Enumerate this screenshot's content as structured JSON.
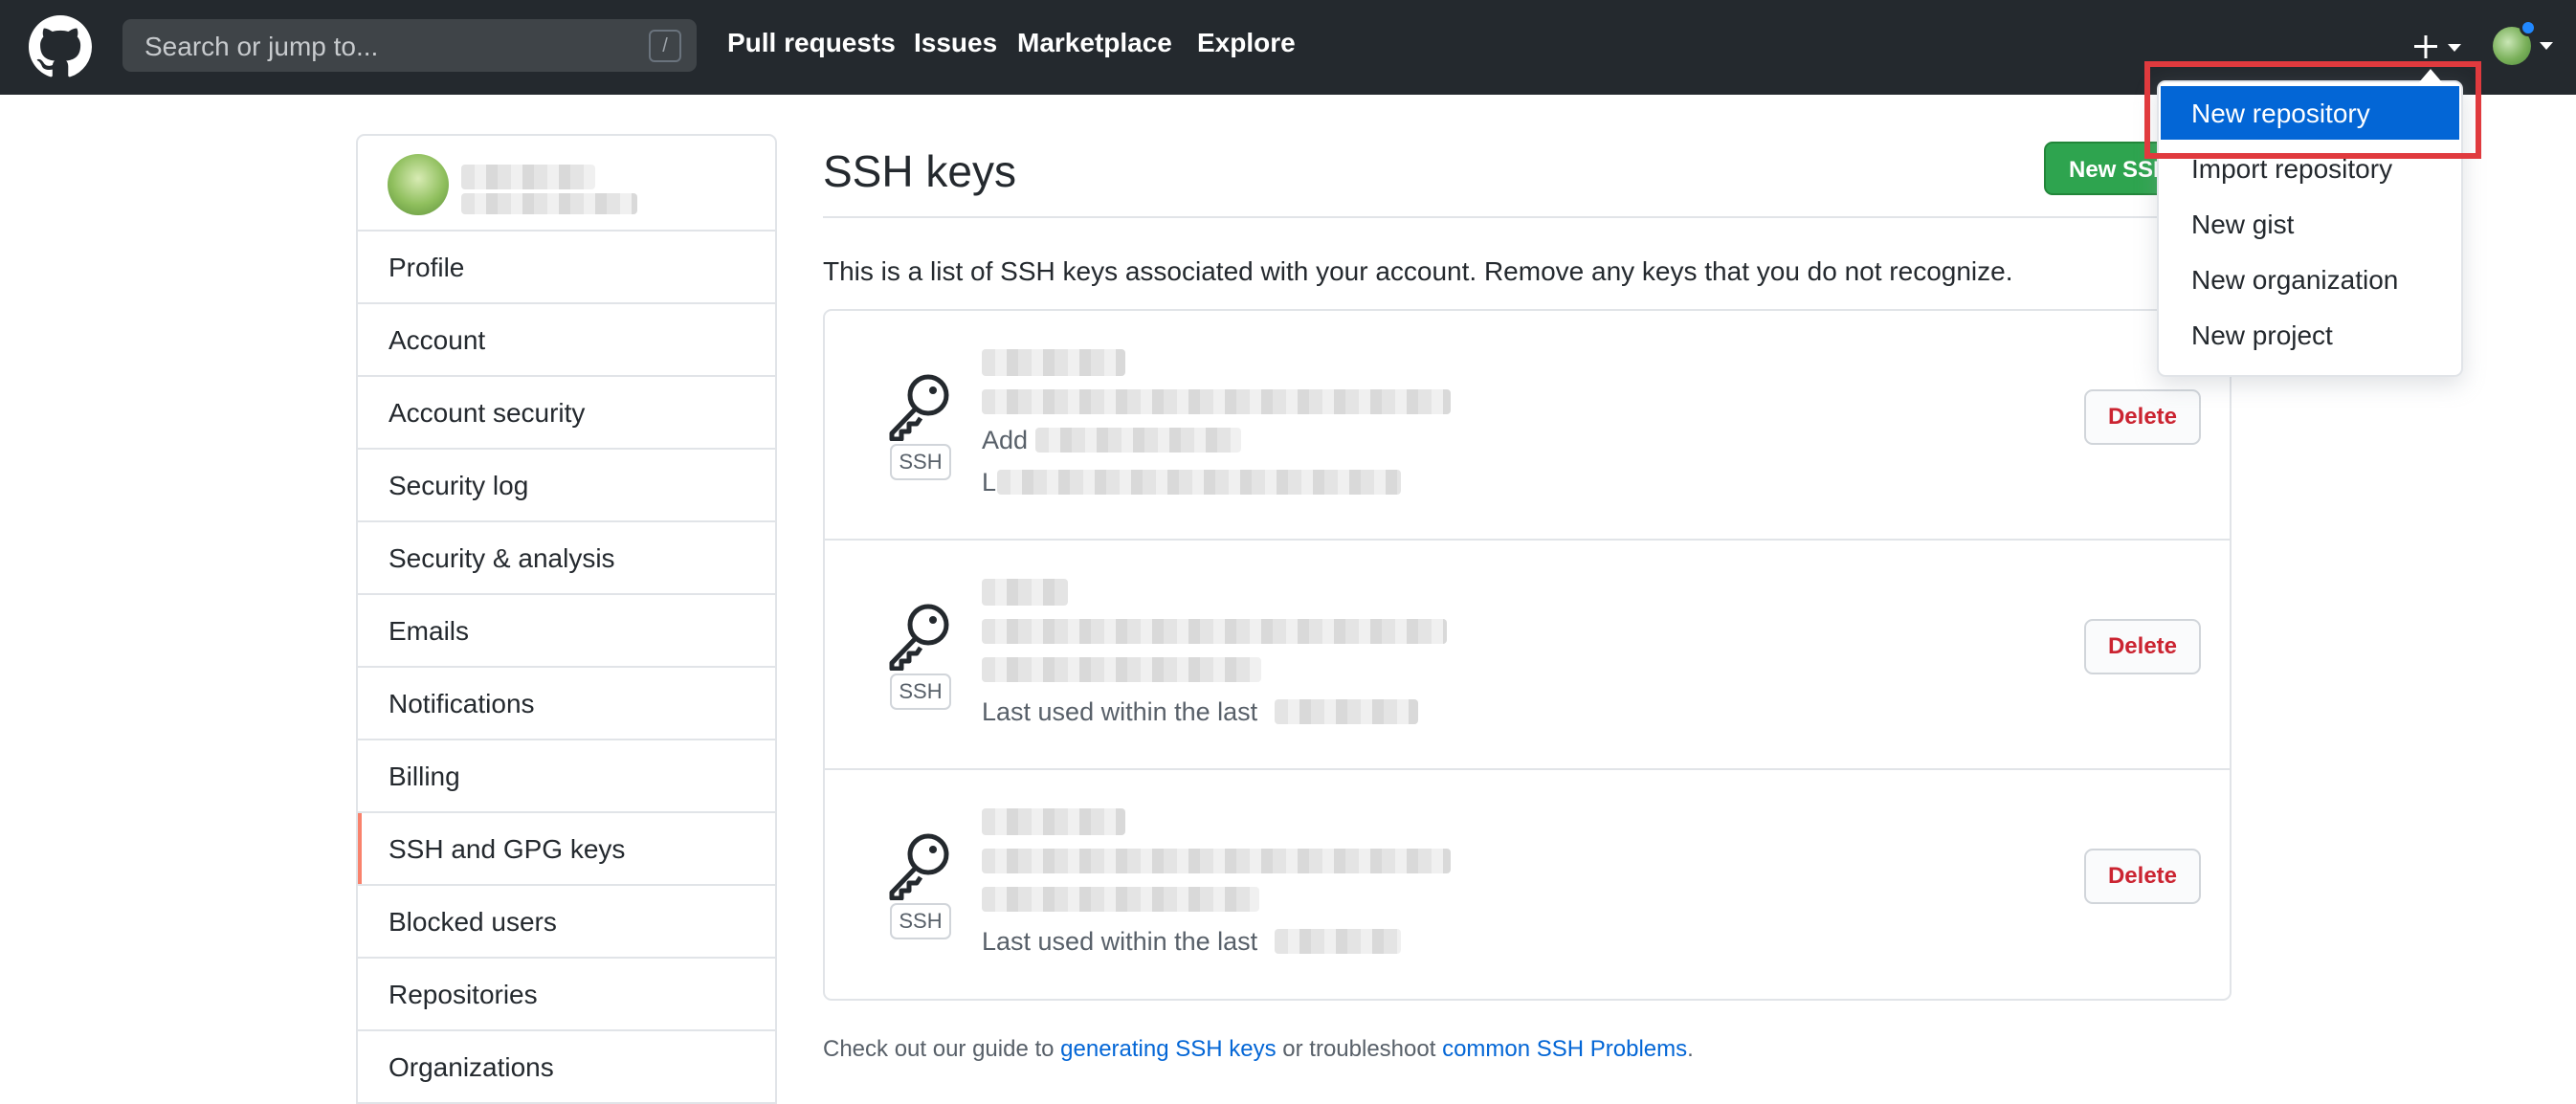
{
  "header": {
    "search_placeholder": "Search or jump to...",
    "search_shortcut": "/",
    "nav": [
      "Pull requests",
      "Issues",
      "Marketplace",
      "Explore"
    ]
  },
  "dropdown": {
    "items": [
      "New repository",
      "Import repository",
      "New gist",
      "New organization",
      "New project"
    ]
  },
  "sidebar": {
    "items": [
      "Profile",
      "Account",
      "Account security",
      "Security log",
      "Security & analysis",
      "Emails",
      "Notifications",
      "Billing",
      "SSH and GPG keys",
      "Blocked users",
      "Repositories",
      "Organizations"
    ],
    "active": "SSH and GPG keys"
  },
  "main": {
    "title": "SSH keys",
    "new_button": "New SSH",
    "intro": "This is a list of SSH keys associated with your account. Remove any keys that you do not recognize.",
    "keys": [
      {
        "badge": "SSH",
        "delete": "Delete",
        "partial_added": "Add",
        "partial_used": "L"
      },
      {
        "badge": "SSH",
        "delete": "Delete",
        "partial_used": "Last used within the last"
      },
      {
        "badge": "SSH",
        "delete": "Delete",
        "partial_used": "Last used within the last"
      }
    ],
    "footer": {
      "prefix": "Check out our guide to ",
      "link1": "generating SSH keys",
      "middle": " or troubleshoot ",
      "link2": "common SSH Problems",
      "suffix": "."
    }
  },
  "colors": {
    "header_bg": "#24292e",
    "link": "#0366d6",
    "primary_button": "#2ea44f",
    "danger": "#cb2431",
    "highlight": "#0366d6",
    "annotation_box": "#e03a3e",
    "active_marker": "#f9826c"
  }
}
